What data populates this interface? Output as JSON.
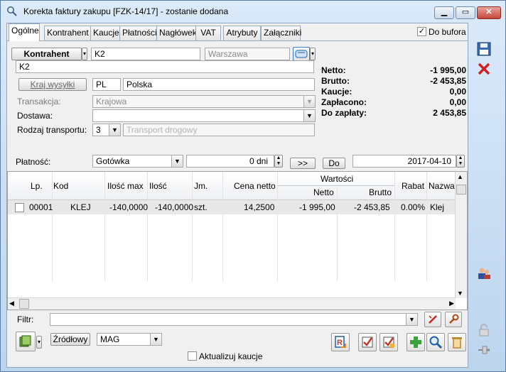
{
  "window": {
    "title": "Korekta faktury zakupu [FZK-14/17]  - zostanie dodana",
    "minimize": "▁",
    "maximize": "▭",
    "close": "✕"
  },
  "tabs": [
    "Ogólne",
    "Kontrahent",
    "Kaucje",
    "Płatności",
    "Nagłówek",
    "VAT",
    "Atrybuty",
    "Załączniki"
  ],
  "active_tab": "Ogólne",
  "buffer": {
    "label": "Do bufora",
    "checked": true,
    "mark": "✓"
  },
  "contractor": {
    "button": "Kontrahent",
    "code": "K2",
    "city": "Warszawa",
    "name": "K2"
  },
  "shipping": {
    "button": "Kraj wysyłki",
    "country_code": "PL",
    "country_name": "Polska"
  },
  "transaction": {
    "label": "Transakcja:",
    "value": "Krajowa"
  },
  "delivery": {
    "label": "Dostawa:",
    "value": ""
  },
  "transport": {
    "label": "Rodzaj transportu:",
    "code": "3",
    "name": "Transport drogowy"
  },
  "totals": {
    "netto_label": "Netto:",
    "netto": "-1 995,00",
    "brutto_label": "Brutto:",
    "brutto": "-2 453,85",
    "kaucje_label": "Kaucje:",
    "kaucje": "0,00",
    "zaplacono_label": "Zapłacono:",
    "zaplacono": "0,00",
    "do_zaplaty_label": "Do zapłaty:",
    "do_zaplaty": "2 453,85"
  },
  "payment": {
    "label": "Płatność:",
    "method": "Gotówka",
    "days": "0 dni",
    "arrow_button": ">>",
    "do_button": "Do",
    "date": "2017-04-10"
  },
  "table": {
    "headers": {
      "lp": "Lp.",
      "kod": "Kod",
      "ilosc_max": "Ilość max",
      "ilosc": "Ilość",
      "jm": "Jm.",
      "cena_netto": "Cena netto",
      "wartosci": "Wartości",
      "netto": "Netto",
      "brutto": "Brutto",
      "rabat": "Rabat",
      "nazwa": "Nazwa"
    },
    "rows": [
      {
        "lp": "00001",
        "kod": "KLEJ",
        "ilosc_max": "-140,0000",
        "ilosc": "-140,0000",
        "jm": "szt.",
        "cena_netto": "14,2500",
        "netto": "-1 995,00",
        "brutto": "-2 453,85",
        "rabat": "0.00%",
        "nazwa": "Klej"
      }
    ]
  },
  "filter": {
    "label": "Filtr:",
    "value": ""
  },
  "source": {
    "button": "Źródłowy",
    "warehouse": "MAG"
  },
  "update_deposits": {
    "label": "Aktualizuj kaucje",
    "checked": false
  },
  "colors": {
    "accent": "#1f5fa8",
    "window_bg": "#c4dbef",
    "row_highlight": "#e8e8e8"
  },
  "icons": [
    "search-icon",
    "save-icon",
    "cancel-icon",
    "people-icon",
    "lock-icon",
    "pin-icon",
    "calendar-icon",
    "filter-clear-icon",
    "wrench-icon",
    "document-icon",
    "check-icon",
    "check-star-icon",
    "add-icon",
    "magnifier-icon",
    "trash-icon",
    "book-icon"
  ]
}
